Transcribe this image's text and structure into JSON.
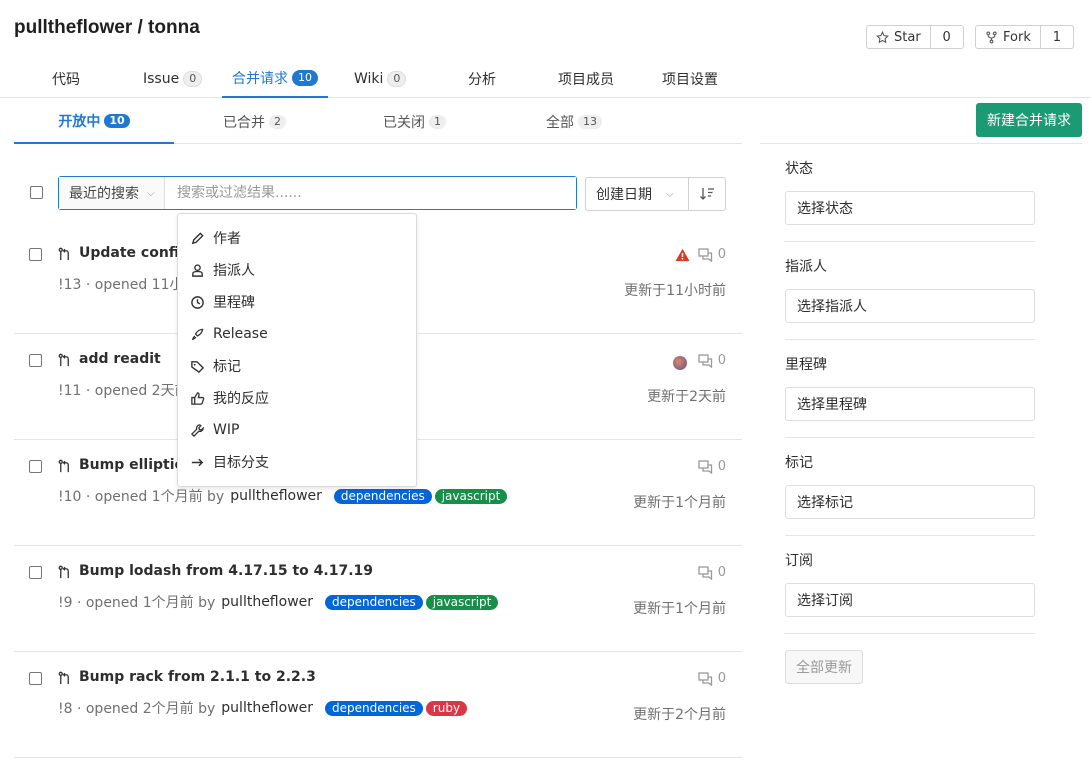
{
  "header": {
    "title": "pulltheflower / tonna",
    "star_label": "Star",
    "star_count": "0",
    "fork_label": "Fork",
    "fork_count": "1"
  },
  "nav": {
    "code": "代码",
    "issue": "Issue",
    "issue_count": "0",
    "mr": "合并请求",
    "mr_count": "10",
    "wiki": "Wiki",
    "wiki_count": "0",
    "analytics": "分析",
    "members": "项目成员",
    "settings": "项目设置"
  },
  "subtabs": {
    "open": "开放中",
    "open_count": "10",
    "merged": "已合并",
    "merged_count": "2",
    "closed": "已关闭",
    "closed_count": "1",
    "all": "全部",
    "all_count": "13",
    "new_mr": "新建合并请求"
  },
  "filter": {
    "recent": "最近的搜索",
    "placeholder": "搜索或过滤结果......",
    "sort": "创建日期"
  },
  "dropdown": {
    "items": [
      "作者",
      "指派人",
      "里程碑",
      "Release",
      "标记",
      "我的反应",
      "WIP",
      "目标分支"
    ]
  },
  "mrs": [
    {
      "title": "Update config.",
      "meta": "!13 · opened 11小时",
      "author": "",
      "labels": [],
      "comments": "0",
      "updated": "更新于11小时前"
    },
    {
      "title": "add readit",
      "meta": "!11 · opened 2天前",
      "author": "",
      "labels": [],
      "comments": "0",
      "updated": "更新于2天前"
    },
    {
      "title": "Bump elliptic f",
      "meta": "!10 · opened 1个月前 by",
      "author": "pulltheflower",
      "labels": [
        "dependencies",
        "javascript"
      ],
      "comments": "0",
      "updated": "更新于1个月前"
    },
    {
      "title": "Bump lodash from 4.17.15 to 4.17.19",
      "meta": "!9 · opened 1个月前 by",
      "author": "pulltheflower",
      "labels": [
        "dependencies",
        "javascript"
      ],
      "comments": "0",
      "updated": "更新于1个月前"
    },
    {
      "title": "Bump rack from 2.1.1 to 2.2.3",
      "meta": "!8 · opened 2个月前 by",
      "author": "pulltheflower",
      "labels": [
        "dependencies",
        "ruby"
      ],
      "comments": "0",
      "updated": "更新于2个月前"
    }
  ],
  "label_colors": {
    "dependencies": "#0366d6",
    "javascript": "#168f48",
    "ruby": "#dc3545"
  },
  "sidebar": {
    "status_head": "状态",
    "status_input": "选择状态",
    "assignee_head": "指派人",
    "assignee_input": "选择指派人",
    "milestone_head": "里程碑",
    "milestone_input": "选择里程碑",
    "label_head": "标记",
    "label_input": "选择标记",
    "subscription_head": "订阅",
    "subscription_input": "选择订阅",
    "update_all": "全部更新"
  },
  "colors": {
    "accent": "#1f78d1",
    "primary_button": "#1b9a74"
  }
}
